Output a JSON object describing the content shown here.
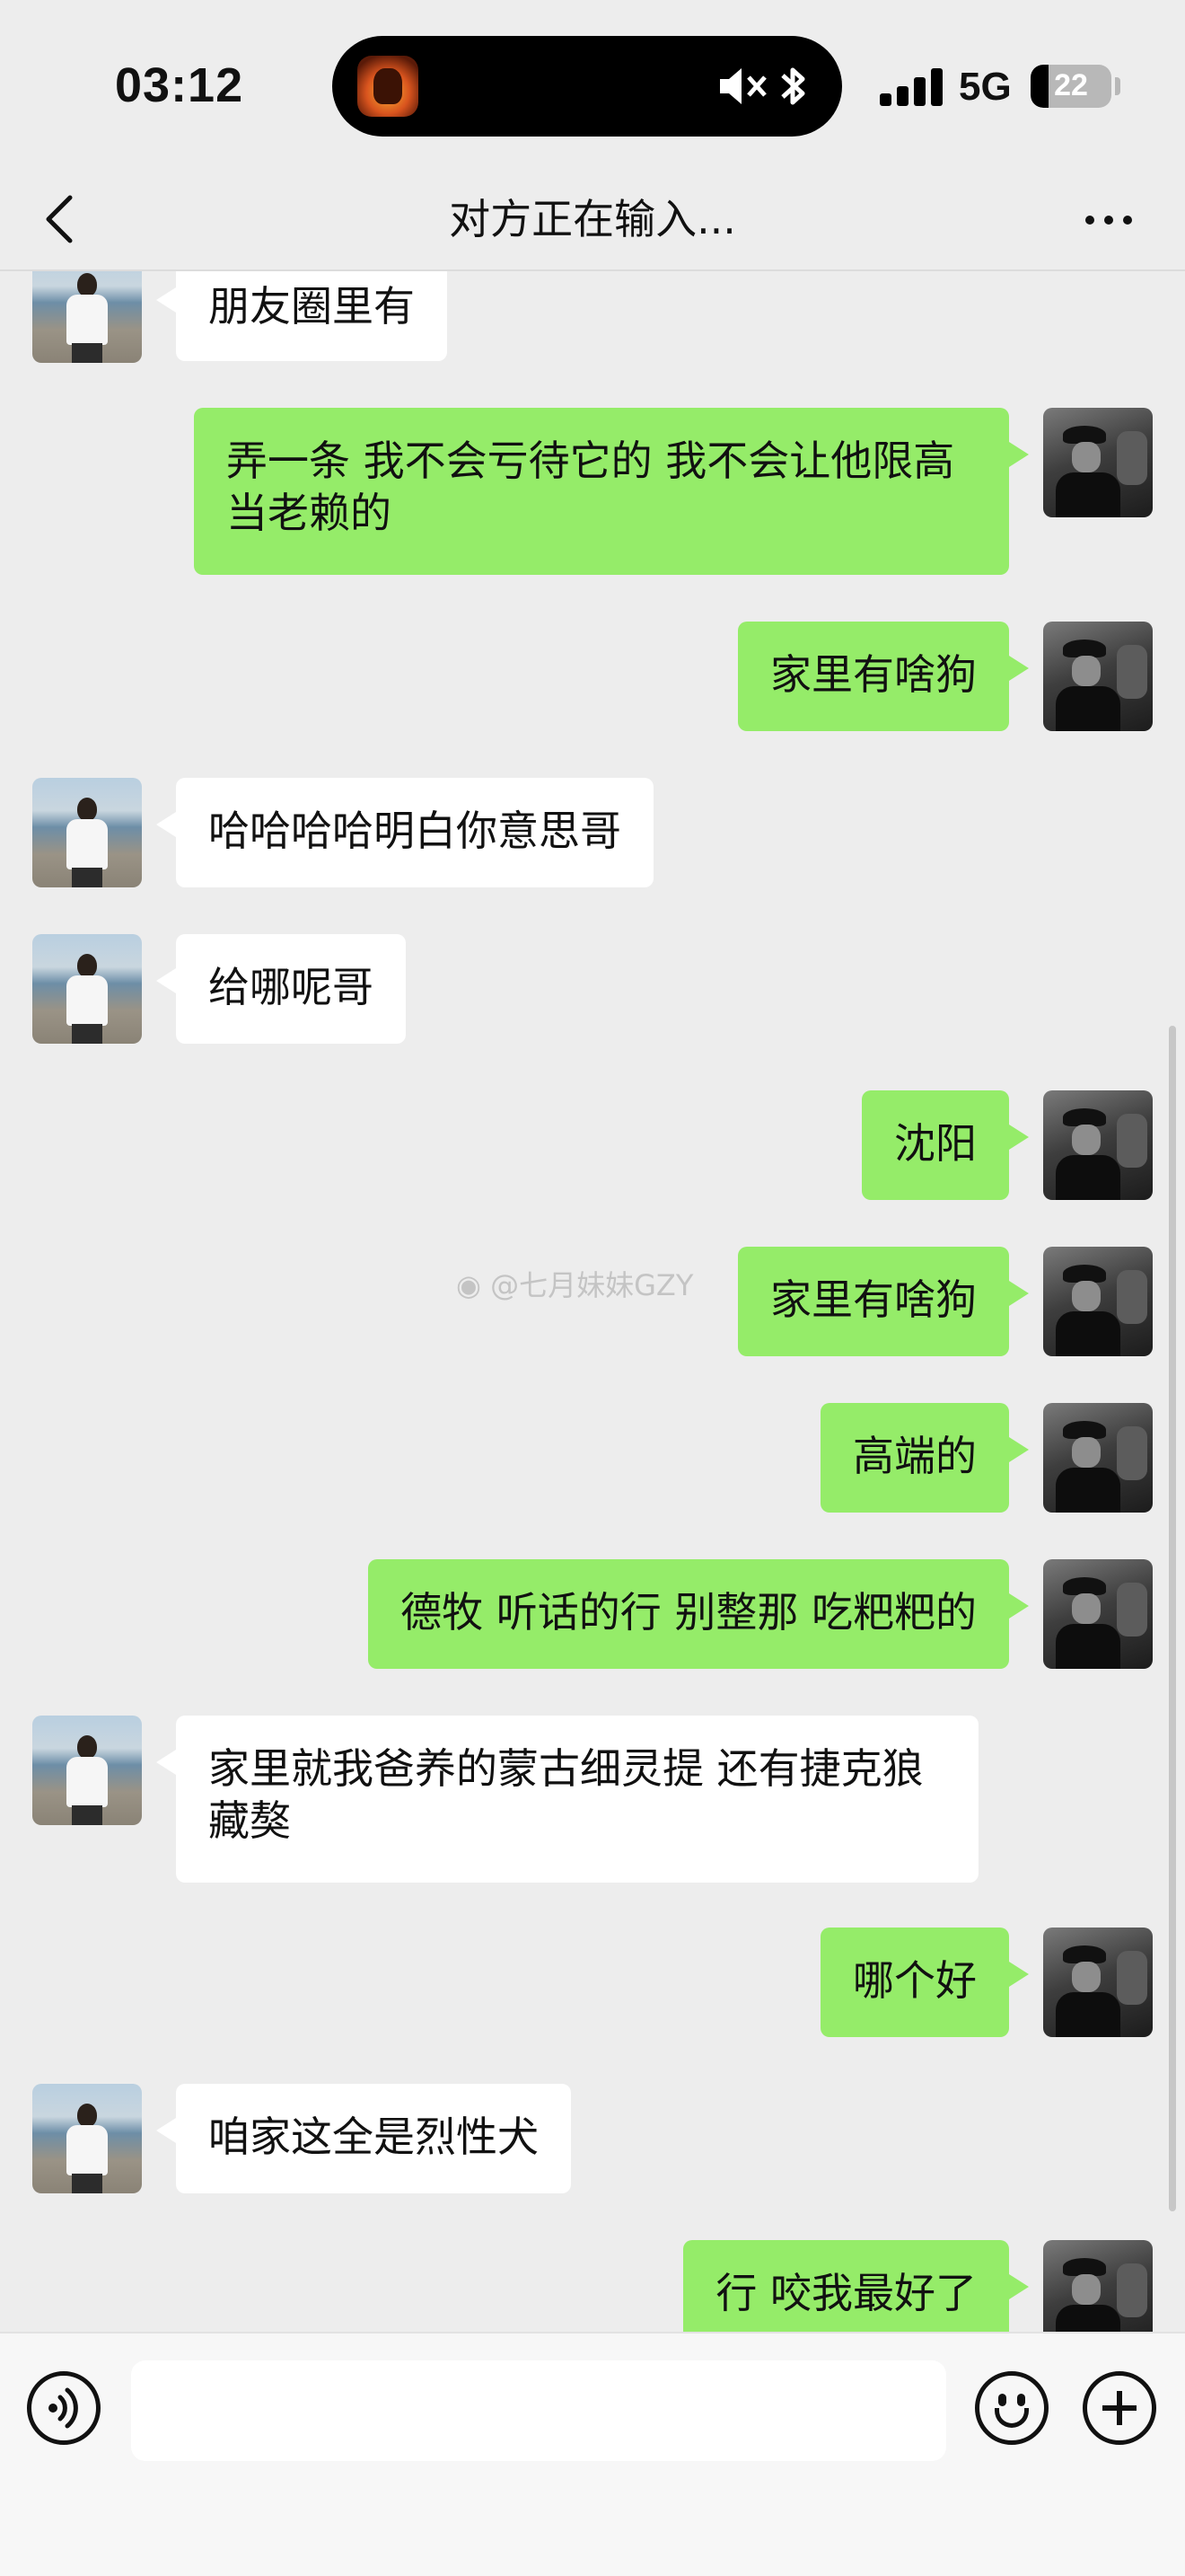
{
  "status_bar": {
    "time": "03:12",
    "network": "5G",
    "battery_level": "22",
    "signal_icon": "cellular-signal-icon",
    "mute_icon": "speaker-muted-icon",
    "bluetooth_icon": "bluetooth-icon"
  },
  "nav": {
    "title": "对方正在输入...",
    "back_icon": "chevron-left-icon",
    "more_icon": "ellipsis-icon"
  },
  "colors": {
    "background": "#ededed",
    "bubble_sent": "#95ec69",
    "bubble_received": "#ffffff"
  },
  "messages": [
    {
      "side": "left",
      "text": "朋友圈里有"
    },
    {
      "side": "right",
      "text": "弄一条 我不会亏待它的 我不会让他限高 当老赖的"
    },
    {
      "side": "right",
      "text": "家里有啥狗"
    },
    {
      "side": "left",
      "text": "哈哈哈哈明白你意思哥"
    },
    {
      "side": "left",
      "text": "给哪呢哥"
    },
    {
      "side": "right",
      "text": "沈阳"
    },
    {
      "side": "right",
      "text": "家里有啥狗"
    },
    {
      "side": "right",
      "text": "高端的"
    },
    {
      "side": "right",
      "text": "德牧 听话的行 别整那 吃粑粑的"
    },
    {
      "side": "left",
      "text": "家里就我爸养的蒙古细灵提 还有捷克狼 藏獒"
    },
    {
      "side": "right",
      "text": "哪个好"
    },
    {
      "side": "left",
      "text": "咱家这全是烈性犬"
    },
    {
      "side": "right",
      "text": "行 咬我最好了"
    }
  ],
  "watermark": "@七月妹妹GZY",
  "input_bar": {
    "placeholder": "",
    "voice_icon": "voice-input-icon",
    "emoji_icon": "emoji-icon",
    "plus_icon": "plus-icon"
  }
}
